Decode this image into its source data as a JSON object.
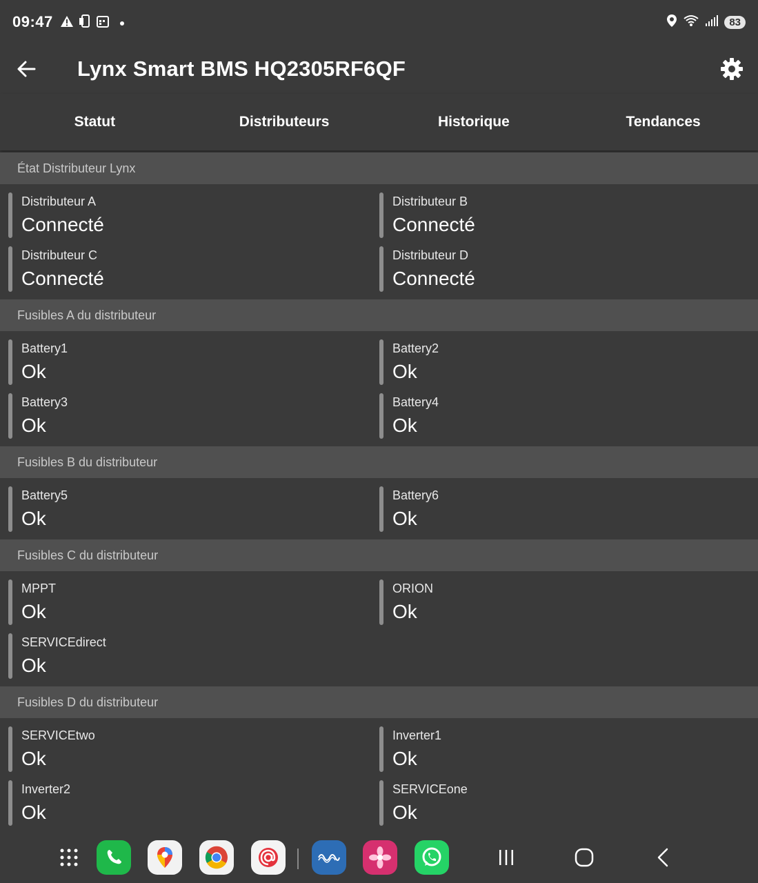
{
  "status_bar": {
    "time": "09:47",
    "battery": "83",
    "left_icons": [
      "alert-icon",
      "phone-storage-icon",
      "calendar-icon",
      "dot-icon"
    ],
    "right_icons": [
      "location-icon",
      "wifi-icon",
      "signal-icon"
    ]
  },
  "app_bar": {
    "title": "Lynx Smart BMS HQ2305RF6QF"
  },
  "tabs": [
    {
      "label": "Statut"
    },
    {
      "label": "Distributeurs"
    },
    {
      "label": "Historique"
    },
    {
      "label": "Tendances"
    }
  ],
  "sections": [
    {
      "title": "État Distributeur Lynx",
      "items": [
        {
          "label": "Distributeur A",
          "value": "Connecté"
        },
        {
          "label": "Distributeur B",
          "value": "Connecté"
        },
        {
          "label": "Distributeur C",
          "value": "Connecté"
        },
        {
          "label": "Distributeur D",
          "value": "Connecté"
        }
      ]
    },
    {
      "title": "Fusibles A du distributeur",
      "items": [
        {
          "label": "Battery1",
          "value": "Ok"
        },
        {
          "label": "Battery2",
          "value": "Ok"
        },
        {
          "label": "Battery3",
          "value": "Ok"
        },
        {
          "label": "Battery4",
          "value": "Ok"
        }
      ]
    },
    {
      "title": "Fusibles B du distributeur",
      "items": [
        {
          "label": "Battery5",
          "value": "Ok"
        },
        {
          "label": "Battery6",
          "value": "Ok"
        }
      ]
    },
    {
      "title": "Fusibles C du distributeur",
      "items": [
        {
          "label": "MPPT",
          "value": "Ok"
        },
        {
          "label": "ORION",
          "value": "Ok"
        },
        {
          "label": "SERVICEdirect",
          "value": "Ok"
        }
      ]
    },
    {
      "title": "Fusibles D du distributeur",
      "items": [
        {
          "label": "SERVICEtwo",
          "value": "Ok"
        },
        {
          "label": "Inverter1",
          "value": "Ok"
        },
        {
          "label": "Inverter2",
          "value": "Ok"
        },
        {
          "label": "SERVICEone",
          "value": "Ok"
        }
      ]
    }
  ],
  "dock": {
    "apps": [
      "app-drawer-icon",
      "phone-app-icon",
      "maps-app-icon",
      "chrome-app-icon",
      "email-app-icon",
      "victron-app-icon",
      "gallery-app-icon",
      "whatsapp-app-icon"
    ],
    "nav_keys": [
      "recents-icon",
      "home-icon",
      "back-nav-icon"
    ]
  },
  "colors": {
    "background": "#3a3a3a",
    "section_header": "#505050",
    "indicator_bar": "#8d8d8d"
  }
}
